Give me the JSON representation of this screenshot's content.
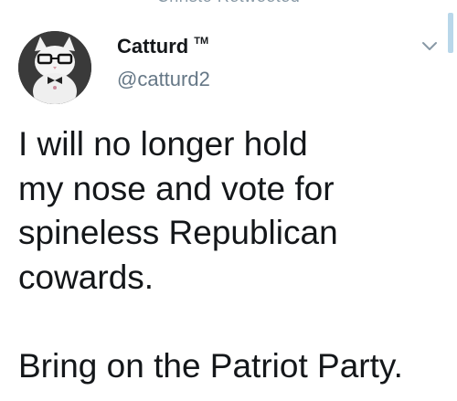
{
  "retweet": {
    "text": "Christo Retweeted"
  },
  "author": {
    "display_name": "Catturd",
    "trademark": "TM",
    "handle": "@catturd2",
    "avatar_icon": "cat-with-glasses-avatar"
  },
  "menu": {
    "icon": "chevron-down-icon"
  },
  "tweet": {
    "lines": [
      "I will no longer hold",
      "my nose and vote for",
      "spineless Republican",
      "cowards."
    ],
    "closing": "Bring on the Patriot Party."
  },
  "colors": {
    "text_primary": "#14171a",
    "text_secondary": "#657786",
    "accent": "#b9d7ea"
  }
}
